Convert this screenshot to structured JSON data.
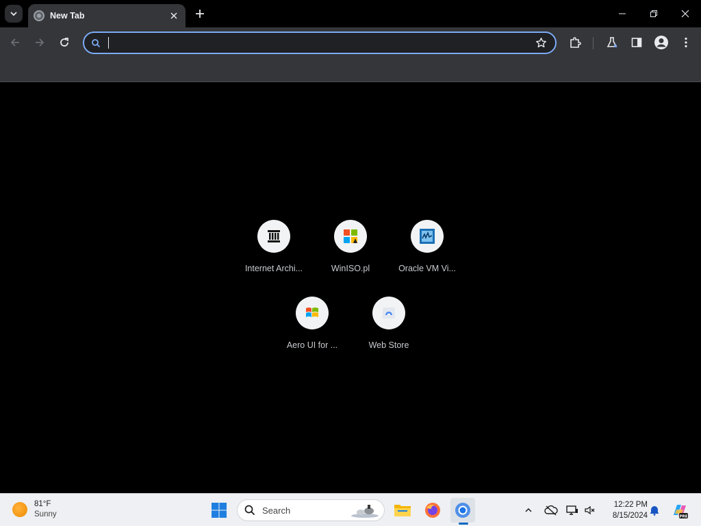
{
  "browser": {
    "tab": {
      "title": "New Tab"
    },
    "omnibox": {
      "value": "",
      "placeholder": ""
    }
  },
  "shortcuts": [
    {
      "label": "Internet Archi...",
      "icon": "internet-archive-icon"
    },
    {
      "label": "WinISO.pl",
      "icon": "winiso-icon"
    },
    {
      "label": "Oracle VM Vi...",
      "icon": "virtualbox-icon"
    },
    {
      "label": "Aero UI for ...",
      "icon": "windows-logo-icon"
    },
    {
      "label": "Web Store",
      "icon": "web-store-icon"
    }
  ],
  "taskbar": {
    "weather": {
      "temp": "81°F",
      "condition": "Sunny"
    },
    "search_label": "Search",
    "clock": {
      "time": "12:22 PM",
      "date": "8/15/2024"
    }
  },
  "colors": {
    "omnibox_focus": "#7cacf8",
    "toolbar": "#35363a",
    "page_bg": "#000000",
    "taskbar": "#eef0f3",
    "accent": "#0067c0"
  }
}
